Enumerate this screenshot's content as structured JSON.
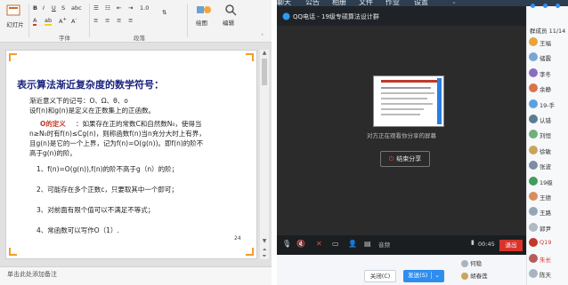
{
  "ppt": {
    "ribbon": {
      "thumbnail_view": "幻灯片",
      "font_group": "字体",
      "paragraph_group": "段落",
      "drawing": "绘图",
      "editing": "编辑",
      "toolbar_numbers": "1.0"
    },
    "slide": {
      "title": "表示算法渐近复杂度的数学符号：",
      "line1": "渐近意义下的记号：O、Ω、θ、o",
      "line2": "设f(n)和g(n)是定义在正数集上的正函数。",
      "def_label": "O的定义",
      "def_line1": "：如果存在正的常数C和自然数N₀，使得当",
      "def_line2": "n≥N₀时有f(n)≤Cg(n)，则称函数f(n)当n充分大时上有界，",
      "def_line3": "且g(n)是它的一个上界，记为f(n)=O(g(n))。即f(n)的阶不",
      "def_line4": "高于g(n)的阶。",
      "item1": "1、f(n)=O(g(n)),f(n)的阶不高于g（n）的阶；",
      "item2": "2、可能存在多个正数c，只要取其中一个即可；",
      "item3": "3、对前面有限个值可以不满足不等式；",
      "item4": "4、常函数可以写作O（1）.",
      "page_number": "24"
    },
    "notes_placeholder": "单击此处添加备注"
  },
  "qq_top_tabs": [
    "聊天",
    "公告",
    "相册",
    "文件",
    "作业",
    "设置"
  ],
  "qq": {
    "window_title": "QQ电话 - 19级专硕算法设计群",
    "share_status": "对方正在观看你分享的屏幕",
    "end_share": "结束分享",
    "quality": "音频",
    "timer": "00:45",
    "exit": "退出"
  },
  "chat": {
    "close": "关闭(C)",
    "send": "发送(S)"
  },
  "attendees": [
    "何稳",
    "胡春莲"
  ],
  "members": {
    "header": "群成员 11/14",
    "list": [
      {
        "name": "王福",
        "color": "#e8a33c"
      },
      {
        "name": "储震",
        "color": "#7aa5d6"
      },
      {
        "name": "李冬",
        "color": "#8a6fbf"
      },
      {
        "name": "余静",
        "color": "#d9734b"
      },
      {
        "name": "19-手",
        "color": "#5aa1e0"
      },
      {
        "name": "认错",
        "color": "#5c7c91"
      },
      {
        "name": "刘恒",
        "color": "#6fb07c"
      },
      {
        "name": "徐敏",
        "color": "#c9a55b"
      },
      {
        "name": "张波",
        "color": "#7d8da3"
      },
      {
        "name": "19级",
        "color": "#3f9e5a"
      },
      {
        "name": "王德",
        "color": "#d98c5f"
      },
      {
        "name": "王路",
        "color": "#96a4b8"
      },
      {
        "name": "郭尹",
        "color": "#b0b9c4"
      },
      {
        "name": "Q19",
        "color": "#c0392b",
        "highlight": true
      },
      {
        "name": "朱长",
        "color": "#b45c5c",
        "highlight": true
      },
      {
        "name": "陈天",
        "color": "#a9b4c0"
      }
    ]
  }
}
